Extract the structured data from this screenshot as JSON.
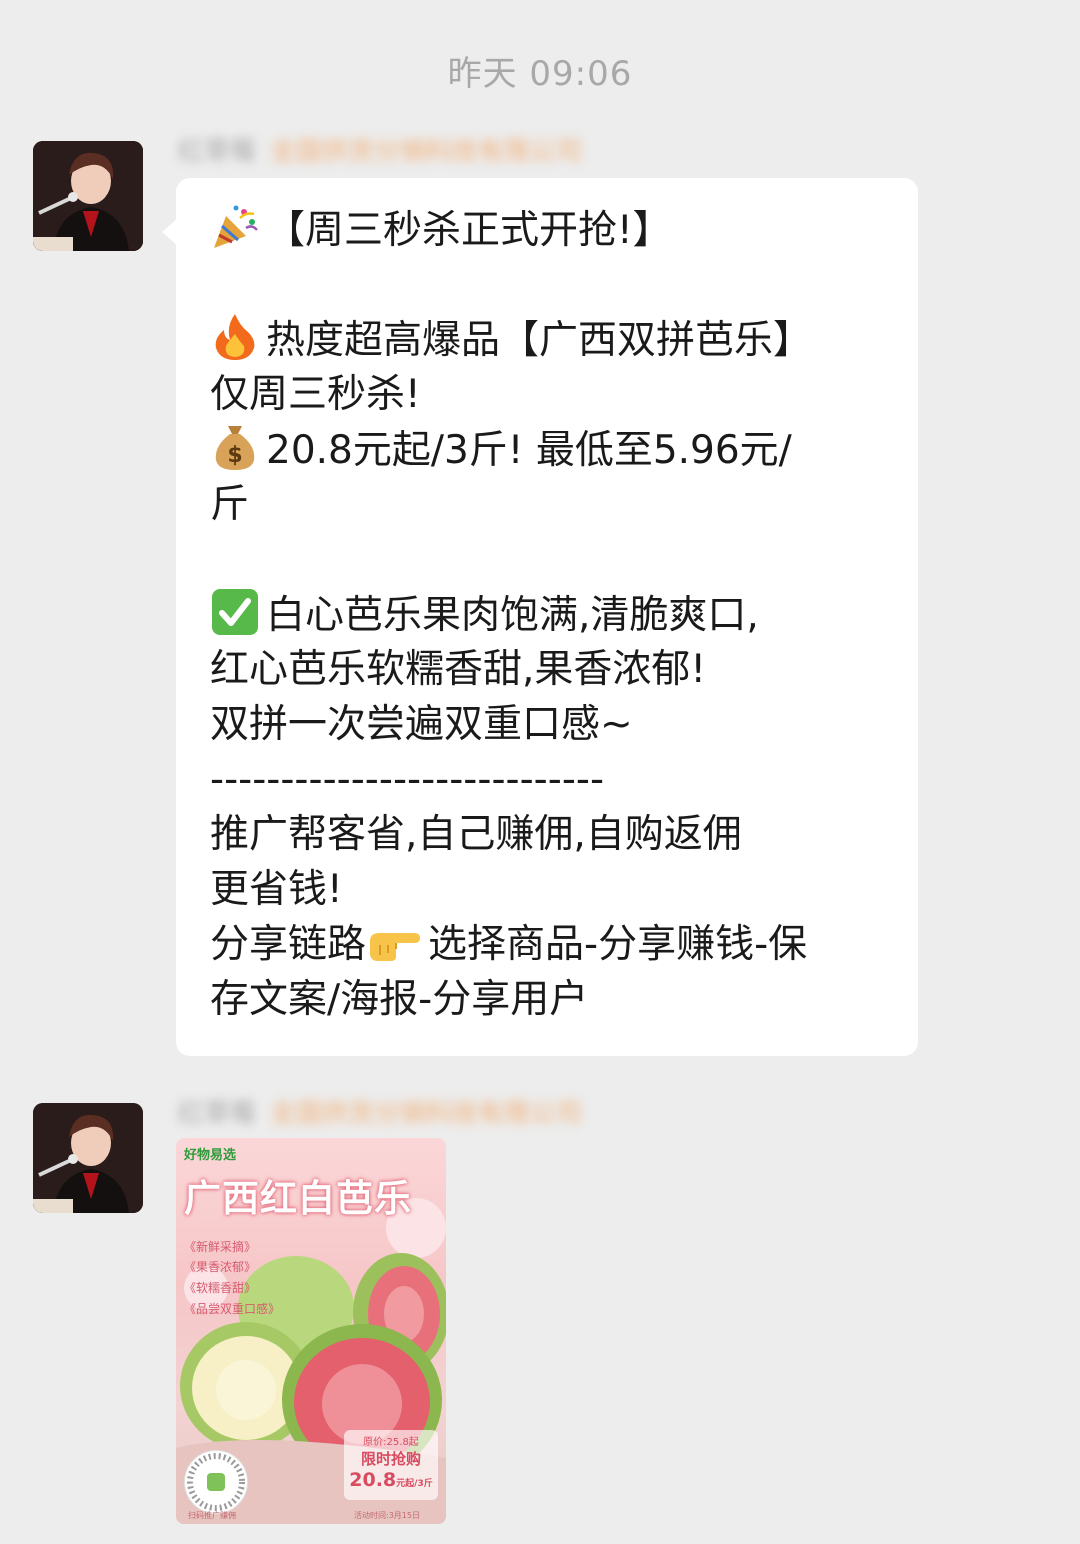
{
  "timestamp": "昨天 09:06",
  "messages": [
    {
      "sender_name": "红草莓",
      "sender_org": "全国供货分销科技有限公司",
      "lines": [
        {
          "emoji": "party-popper",
          "text": "【周三秒杀正式开抢!】"
        },
        {
          "blank": true
        },
        {
          "emoji": "fire",
          "text": "热度超高爆品【广西双拼芭乐】"
        },
        {
          "text": "仅周三秒杀!"
        },
        {
          "emoji": "money-bag",
          "text": "20.8元起/3斤!  最低至5.96元/"
        },
        {
          "text": "斤"
        },
        {
          "blank": true
        },
        {
          "emoji": "check-mark",
          "text": "白心芭乐果肉饱满,清脆爽口,"
        },
        {
          "text": "红心芭乐软糯香甜,果香浓郁!"
        },
        {
          "text": "双拼一次尝遍双重口感~"
        },
        {
          "text": "----------------------------"
        },
        {
          "text": "推广帮客省,自己赚佣,自购返佣"
        },
        {
          "text": "更省钱!"
        },
        {
          "text": "分享链路",
          "emoji_after": "pointing-hand",
          "text_after": "选择商品-分享赚钱-保"
        },
        {
          "text": "存文案/海报-分享用户"
        }
      ]
    },
    {
      "sender_name": "红草莓",
      "sender_org": "全国供货分销科技有限公司",
      "poster": {
        "brand": "好物易选",
        "title": "广西红白芭乐",
        "tags": [
          "《新鲜采摘》",
          "《果香浓郁》",
          "《软糯香甜》",
          "《品尝双重口感》"
        ],
        "original_price": "原价:25.8起",
        "flash_label": "限时抢购",
        "price": "20.8",
        "price_unit": "元起/3斤",
        "footer_left": "扫码推广赚佣",
        "footer_right": "活动时间:3月15日"
      }
    }
  ]
}
